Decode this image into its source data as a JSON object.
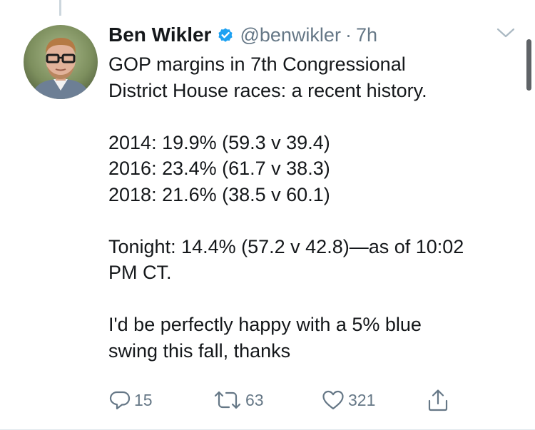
{
  "tweet": {
    "author": {
      "name": "Ben Wikler",
      "handle": "@benwikler",
      "separator": "·",
      "time": "7h",
      "verified_icon": "verified-badge-icon",
      "avatar_icon": "user-avatar"
    },
    "text": {
      "intro": [
        "GOP margins in 7th Congressional",
        "District House races: a recent history."
      ],
      "history": [
        "2014: 19.9% (59.3 v 39.4)",
        "2016: 23.4% (61.7 v 38.3)",
        "2018: 21.6% (38.5 v 60.1)"
      ],
      "tonight": [
        "Tonight: 14.4% (57.2 v 42.8)—as of 10:02",
        "PM CT."
      ],
      "closing": [
        "I'd be perfectly happy with a 5% blue",
        "swing this fall, thanks"
      ]
    },
    "actions": {
      "reply": {
        "icon": "reply-icon",
        "count": "15"
      },
      "retweet": {
        "icon": "retweet-icon",
        "count": "63"
      },
      "like": {
        "icon": "heart-icon",
        "count": "321"
      },
      "share": {
        "icon": "share-icon"
      }
    },
    "menu_icon": "chevron-down-icon"
  },
  "colors": {
    "text": "#14171a",
    "secondary": "#657786",
    "verified": "#1da1f2",
    "divider": "#e1e8ed",
    "scrollbar": "#5f6367"
  }
}
